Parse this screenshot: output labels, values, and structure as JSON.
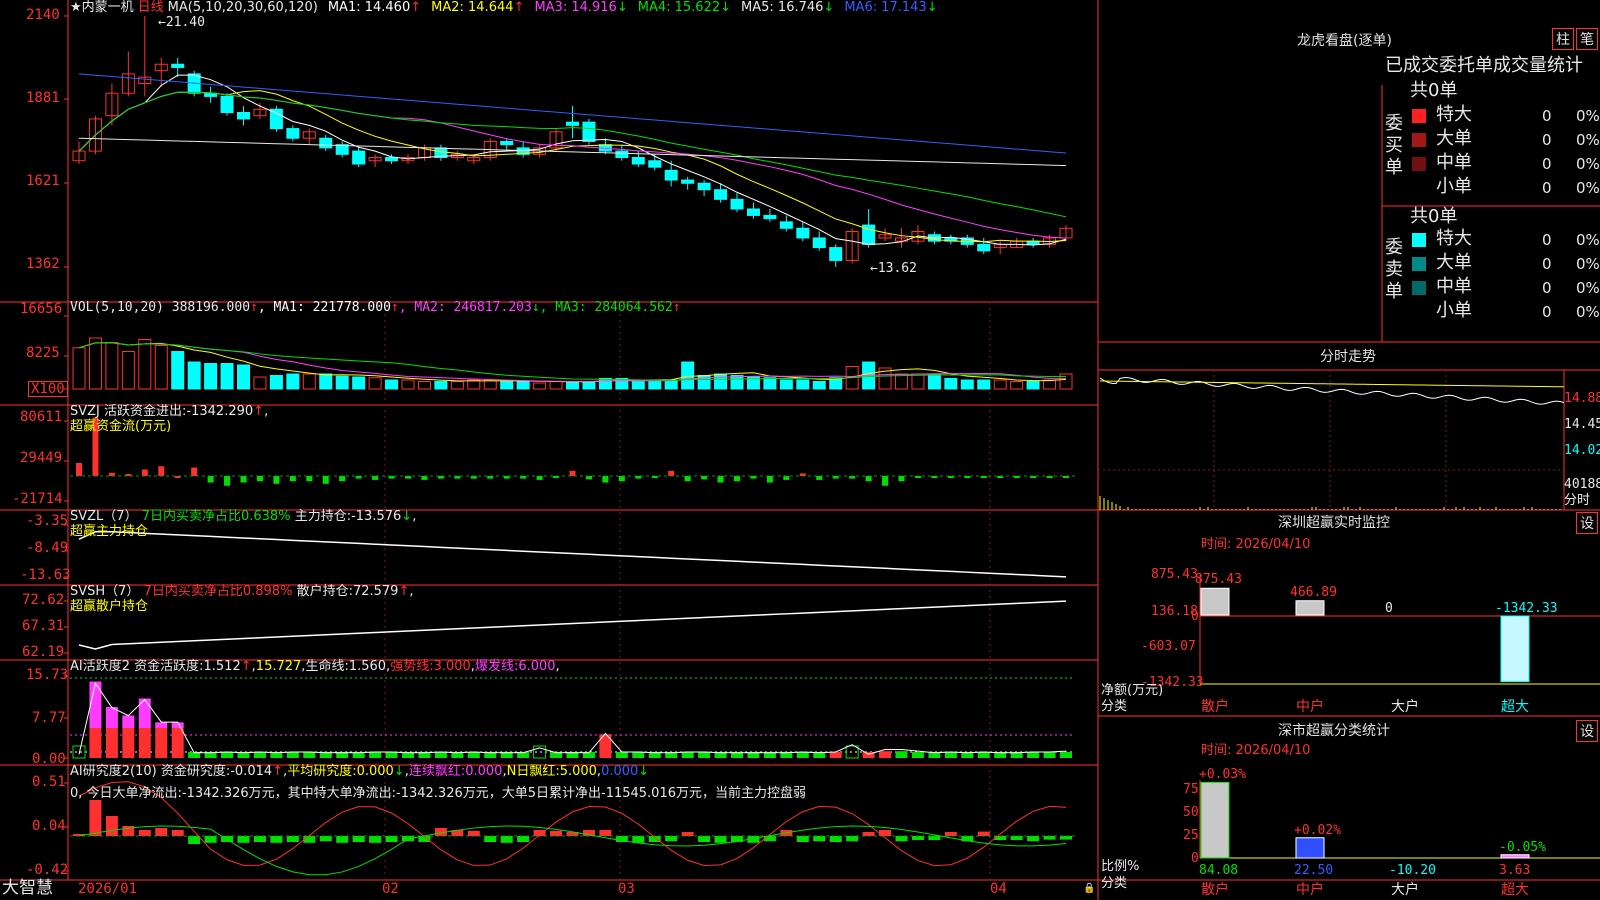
{
  "app": {
    "brand": "大智慧",
    "stock_title": "★内蒙一机",
    "period": "日线",
    "ma_params": "MA(5,10,20,30,60,120)",
    "ma_values": [
      {
        "label": "MA1:",
        "value": "14.460",
        "arrow": "↑",
        "color": "#ffffff"
      },
      {
        "label": "MA2:",
        "value": "14.644",
        "arrow": "↑",
        "color": "#ffff00"
      },
      {
        "label": "MA3:",
        "value": "14.916",
        "arrow": "↓",
        "color": "#ff3cff"
      },
      {
        "label": "MA4:",
        "value": "15.622",
        "arrow": "↓",
        "color": "#00e000"
      },
      {
        "label": "MA5:",
        "value": "16.746",
        "arrow": "↓",
        "color": "#e8e8e8"
      },
      {
        "label": "MA6:",
        "value": "17.143",
        "arrow": "↓",
        "color": "#3060ff"
      }
    ]
  },
  "main_chart": {
    "y_ticks": [
      "2140",
      "1881",
      "1621",
      "1362"
    ],
    "high_label": "21.40",
    "low_label": "13.62"
  },
  "candles": [
    [
      16.9,
      17.5,
      16.8,
      17.2
    ],
    [
      17.2,
      18.3,
      17.1,
      18.2
    ],
    [
      18.3,
      19.3,
      18.0,
      19.0
    ],
    [
      19.0,
      20.3,
      18.9,
      19.6
    ],
    [
      19.3,
      21.4,
      18.9,
      19.5
    ],
    [
      19.7,
      20.1,
      19.2,
      19.9
    ],
    [
      19.9,
      20.1,
      19.5,
      19.8
    ],
    [
      19.6,
      19.7,
      18.9,
      19.0
    ],
    [
      19.0,
      19.2,
      18.7,
      18.9
    ],
    [
      18.9,
      19.0,
      18.3,
      18.4
    ],
    [
      18.4,
      18.6,
      18.0,
      18.2
    ],
    [
      18.3,
      18.7,
      18.2,
      18.5
    ],
    [
      18.5,
      18.6,
      17.8,
      17.9
    ],
    [
      17.9,
      18.0,
      17.5,
      17.6
    ],
    [
      17.6,
      17.9,
      17.4,
      17.8
    ],
    [
      17.6,
      17.7,
      17.2,
      17.3
    ],
    [
      17.4,
      17.5,
      17.0,
      17.1
    ],
    [
      17.2,
      17.3,
      16.7,
      16.8
    ],
    [
      16.9,
      17.1,
      16.7,
      17.0
    ],
    [
      17.0,
      17.1,
      16.8,
      16.9
    ],
    [
      16.9,
      17.1,
      16.8,
      17.0
    ],
    [
      17.0,
      17.4,
      16.9,
      17.3
    ],
    [
      17.3,
      17.4,
      16.9,
      17.0
    ],
    [
      17.0,
      17.2,
      16.9,
      17.1
    ],
    [
      16.9,
      17.1,
      16.8,
      17.0
    ],
    [
      17.0,
      17.6,
      16.9,
      17.5
    ],
    [
      17.5,
      17.6,
      17.2,
      17.4
    ],
    [
      17.3,
      17.5,
      17.0,
      17.1
    ],
    [
      17.1,
      17.4,
      17.0,
      17.3
    ],
    [
      17.3,
      17.9,
      17.2,
      17.8
    ],
    [
      18.1,
      18.6,
      17.6,
      18.0
    ],
    [
      18.1,
      18.2,
      17.4,
      17.5
    ],
    [
      17.4,
      17.6,
      17.1,
      17.2
    ],
    [
      17.2,
      17.4,
      16.9,
      17.0
    ],
    [
      17.0,
      17.2,
      16.7,
      16.8
    ],
    [
      16.9,
      17.1,
      16.6,
      16.7
    ],
    [
      16.6,
      16.9,
      16.1,
      16.3
    ],
    [
      16.3,
      16.4,
      16.0,
      16.2
    ],
    [
      16.2,
      16.3,
      15.8,
      16.0
    ],
    [
      16.0,
      16.2,
      15.6,
      15.7
    ],
    [
      15.7,
      15.9,
      15.3,
      15.4
    ],
    [
      15.4,
      15.6,
      15.1,
      15.2
    ],
    [
      15.2,
      15.4,
      15.0,
      15.1
    ],
    [
      15.0,
      15.2,
      14.7,
      14.8
    ],
    [
      14.8,
      15.0,
      14.4,
      14.5
    ],
    [
      14.5,
      14.7,
      14.1,
      14.2
    ],
    [
      14.2,
      14.3,
      13.6,
      13.8
    ],
    [
      13.8,
      14.8,
      13.7,
      14.7
    ],
    [
      14.9,
      15.4,
      14.2,
      14.3
    ],
    [
      14.5,
      14.8,
      14.4,
      14.6
    ],
    [
      14.4,
      14.8,
      14.2,
      14.5
    ],
    [
      14.4,
      14.9,
      14.3,
      14.7
    ],
    [
      14.6,
      14.7,
      14.3,
      14.4
    ],
    [
      14.5,
      14.6,
      14.3,
      14.4
    ],
    [
      14.5,
      14.6,
      14.2,
      14.3
    ],
    [
      14.3,
      14.5,
      14.0,
      14.1
    ],
    [
      14.2,
      14.4,
      14.0,
      14.3
    ],
    [
      14.2,
      14.5,
      14.2,
      14.4
    ],
    [
      14.4,
      14.5,
      14.2,
      14.3
    ],
    [
      14.3,
      14.6,
      14.2,
      14.5
    ],
    [
      14.5,
      14.9,
      14.4,
      14.8
    ]
  ],
  "volume": {
    "header": "VOL(5,10,20)",
    "value": "388196.000",
    "arrow": "↑",
    "ma": [
      {
        "label": "MA1:",
        "value": "221778.000",
        "arrow": "↑",
        "color": "#ffffff"
      },
      {
        "label": "MA2:",
        "value": "246817.203",
        "arrow": "↓",
        "color": "#ff3cff"
      },
      {
        "label": "MA3:",
        "value": "284064.562",
        "arrow": "↑",
        "color": "#00e000"
      }
    ],
    "y_ticks": [
      "16656",
      "8225"
    ],
    "unit": "X100",
    "bars": [
      0.55,
      0.68,
      0.62,
      0.5,
      0.66,
      0.58,
      0.5,
      0.36,
      0.34,
      0.34,
      0.32,
      0.16,
      0.18,
      0.2,
      0.2,
      0.2,
      0.17,
      0.16,
      0.15,
      0.12,
      0.12,
      0.1,
      0.1,
      0.1,
      0.12,
      0.12,
      0.1,
      0.1,
      0.08,
      0.1,
      0.1,
      0.1,
      0.14,
      0.14,
      0.1,
      0.12,
      0.12,
      0.36,
      0.18,
      0.2,
      0.18,
      0.16,
      0.15,
      0.12,
      0.12,
      0.1,
      0.15,
      0.3,
      0.36,
      0.28,
      0.2,
      0.2,
      0.2,
      0.14,
      0.12,
      0.12,
      0.12,
      0.1,
      0.1,
      0.12,
      0.2
    ]
  },
  "svzj": {
    "name": "SVZJ",
    "label": "活跃资金进出:",
    "value": "-1342.290",
    "arrow": "↑",
    "subtitle": "超赢资金流(万元)",
    "y_ticks": [
      "80611",
      "29449",
      "-21714"
    ],
    "bars": [
      0.2,
      0.9,
      0.05,
      0.03,
      0.1,
      0.15,
      0,
      0.13,
      -0.1,
      -0.15,
      -0.1,
      -0.08,
      -0.12,
      -0.08,
      -0.08,
      -0.12,
      -0.08,
      -0.04,
      -0.06,
      -0.04,
      -0.04,
      -0.06,
      -0.04,
      -0.04,
      -0.04,
      -0.04,
      -0.04,
      -0.04,
      -0.06,
      -0.03,
      0.08,
      -0.05,
      -0.1,
      -0.08,
      -0.04,
      -0.03,
      0.08,
      -0.08,
      -0.05,
      -0.1,
      -0.08,
      -0.04,
      -0.1,
      -0.06,
      0.04,
      -0.06,
      -0.04,
      -0.04,
      -0.08,
      -0.15,
      -0.08,
      -0.03,
      -0.03,
      -0.03,
      -0.03,
      -0.03,
      -0.03,
      -0.03,
      -0.03,
      -0.03,
      -0.03
    ]
  },
  "svzl": {
    "name": "SVZL（7）",
    "label1": "7日内买卖净占比0.638%",
    "label2": "主力持仓:",
    "value": "-13.576",
    "arrow": "↓",
    "subtitle": "超赢主力持仓",
    "y_ticks": [
      "-3.35",
      "-8.49",
      "-13.63"
    ]
  },
  "svsh": {
    "name": "SVSH（7）",
    "label1": "7日内买卖净占比0.898%",
    "label2": "散户持仓:",
    "value": "72.579",
    "arrow": "↑",
    "subtitle": "超赢散户持仓",
    "y_ticks": [
      "72.62",
      "67.31",
      "62.19"
    ]
  },
  "ai_active": {
    "name": "AI活跃度2",
    "label": "资金活跃度:",
    "value": "1.512",
    "arrow": "↑",
    "v2": "15.727",
    "life_label": "生命线:",
    "life_value": "1.560",
    "strong_label": "强势线:",
    "strong_value": "3.000",
    "burst_label": "爆发线:",
    "burst_value": "6.000",
    "y_ticks": [
      "15.73",
      "7.77",
      "0.00"
    ]
  },
  "ai_research": {
    "name": "AI研究度2(10)",
    "label": "资金研究度:",
    "value": "-0.014",
    "arrow": "↑",
    "avg_label": "平均研究度:",
    "avg_value": "0.000",
    "avg_arrow": "↓",
    "streak_label": "连续飘红:",
    "streak_value": "0.000",
    "n_label": "N日飘红:",
    "n_value": "5.000",
    "n_value2": "0.000",
    "note": "0, 今日大单净流出:-1342.326万元，其中特大单净流出:-1342.326万元，大单5日累计净出-11545.016万元，当前主力控盘弱",
    "y_ticks": [
      "0.51",
      "0.04",
      "-0.42"
    ]
  },
  "x_axis": {
    "labels": [
      "2026/01",
      "02",
      "03",
      "04"
    ]
  },
  "dragon_tiger": {
    "title": "龙虎看盘(逐单)",
    "btn_zhu": "柱",
    "btn_bi": "笔",
    "subtitle": "已成交委托单成交量统计",
    "buy_title": "委买单",
    "sell_title": "委卖单",
    "buy_total": "共0单",
    "sell_total": "共0单",
    "buy_rows": [
      {
        "label": "特大",
        "count": "0",
        "pct": "0%",
        "color": "#ff2020"
      },
      {
        "label": "大单",
        "count": "0",
        "pct": "0%",
        "color": "#a01818"
      },
      {
        "label": "中单",
        "count": "0",
        "pct": "0%",
        "color": "#701010"
      },
      {
        "label": "小单",
        "count": "0",
        "pct": "0%",
        "color": "#000000"
      }
    ],
    "sell_rows": [
      {
        "label": "特大",
        "count": "0",
        "pct": "0%",
        "color": "#00ffff"
      },
      {
        "label": "大单",
        "count": "0",
        "pct": "0%",
        "color": "#008a8a"
      },
      {
        "label": "中单",
        "count": "0",
        "pct": "0%",
        "color": "#006a6a"
      },
      {
        "label": "小单",
        "count": "0",
        "pct": "0%",
        "color": "#000000"
      }
    ]
  },
  "intraday": {
    "title": "分时走势",
    "right_ticks": [
      "14.88",
      "14.45",
      "14.02"
    ],
    "vol_tick": "40188",
    "vol_unit": "分时"
  },
  "monitor": {
    "title": "深圳超赢实时监控",
    "settings": "设",
    "date": "时间: 2026/04/10",
    "y_ticks": [
      "875.43",
      "136.18",
      "0",
      "-603.07",
      "-1342.33"
    ],
    "ylabel1": "净额(万元)",
    "ylabel2": "分类",
    "cats": [
      "散户",
      "中户",
      "大户",
      "超大"
    ],
    "vals": [
      "875.43",
      "466.89",
      "0",
      "-1342.33"
    ]
  },
  "classify": {
    "title": "深市超赢分类统计",
    "settings": "设",
    "date": "时间: 2026/04/10",
    "y_ticks": [
      "75",
      "50",
      "25",
      "0"
    ],
    "ylabel1": "比例%",
    "ylabel2": "分类",
    "top_labels": [
      "+0.03%",
      "+0.02%",
      "",
      "-0.05%"
    ],
    "bottom_vals": [
      "84.08",
      "22.50",
      "-10.20",
      "3.63"
    ],
    "cats": [
      "散户",
      "中户",
      "大户",
      "超大"
    ]
  }
}
